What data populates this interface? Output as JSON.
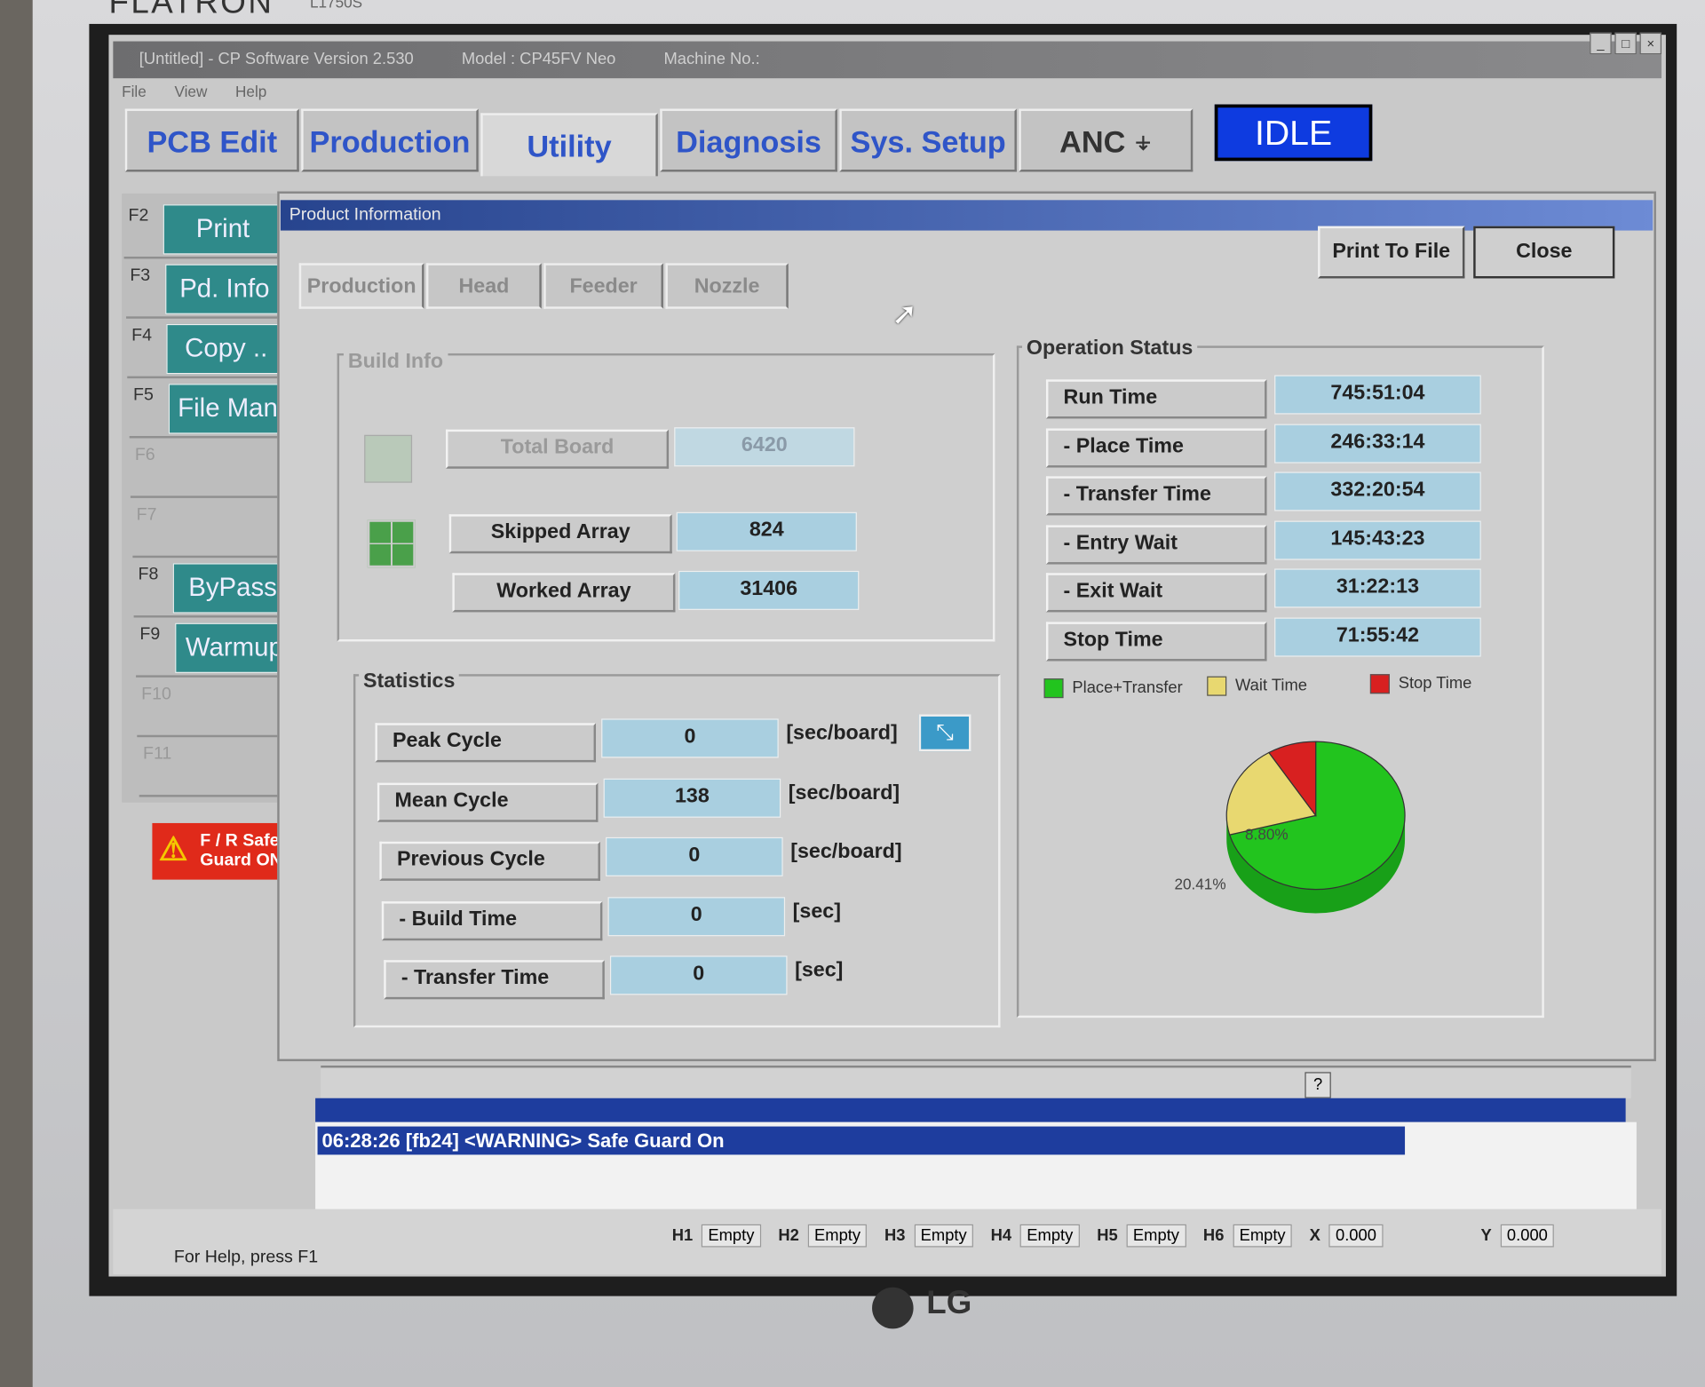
{
  "monitor": {
    "brand": "FLATRON",
    "model": "L1750S",
    "maker": "LG"
  },
  "window": {
    "title": "[Untitled] - CP Software Version 2.530",
    "model": "Model : CP45FV Neo",
    "machine": "Machine No.:"
  },
  "menu": [
    "File",
    "View",
    "Help"
  ],
  "main_tabs": [
    {
      "label": "PCB Edit"
    },
    {
      "label": "Production"
    },
    {
      "label": "Utility"
    },
    {
      "label": "Diagnosis"
    },
    {
      "label": "Sys. Setup"
    },
    {
      "label": "ANC"
    }
  ],
  "active_main_tab": "Utility",
  "state": {
    "label": "IDLE",
    "color": "#0e3be0"
  },
  "fkeys": [
    {
      "key": "F2",
      "label": "Print"
    },
    {
      "key": "F3",
      "label": "Pd. Info"
    },
    {
      "key": "F4",
      "label": "Copy .."
    },
    {
      "key": "F5",
      "label": "File Man"
    },
    {
      "key": "F6",
      "label": ""
    },
    {
      "key": "F7",
      "label": ""
    },
    {
      "key": "F8",
      "label": "ByPass"
    },
    {
      "key": "F9",
      "label": "Warmup"
    },
    {
      "key": "F10",
      "label": ""
    },
    {
      "key": "F11",
      "label": ""
    }
  ],
  "safeguard": {
    "line1": "F / R Safe",
    "line2": "Guard ON"
  },
  "dialog": {
    "title": "Product Information",
    "tabs": [
      "Production",
      "Head",
      "Feeder",
      "Nozzle"
    ],
    "print_to_file": "Print To File",
    "close": "Close",
    "build_info": {
      "title": "Build Info",
      "rows": [
        {
          "label": "Total Board",
          "value": "6420"
        },
        {
          "label": "Skipped Array",
          "value": "824"
        },
        {
          "label": "Worked Array",
          "value": "31406"
        }
      ]
    },
    "statistics": {
      "title": "Statistics",
      "rows": [
        {
          "label": "Peak Cycle",
          "value": "0",
          "unit": "[sec/board]"
        },
        {
          "label": "Mean Cycle",
          "value": "138",
          "unit": "[sec/board]"
        },
        {
          "label": "Previous Cycle",
          "value": "0",
          "unit": "[sec/board]"
        },
        {
          "label": "- Build Time",
          "value": "0",
          "unit": "[sec]"
        },
        {
          "label": "- Transfer Time",
          "value": "0",
          "unit": "[sec]"
        }
      ]
    },
    "operation_status": {
      "title": "Operation Status",
      "rows": [
        {
          "label": "Run Time",
          "value": "745:51:04"
        },
        {
          "label": "- Place Time",
          "value": "246:33:14"
        },
        {
          "label": "- Transfer Time",
          "value": "332:20:54"
        },
        {
          "label": "- Entry Wait",
          "value": "145:43:23"
        },
        {
          "label": "- Exit Wait",
          "value": "31:22:13"
        },
        {
          "label": "Stop Time",
          "value": "71:55:42"
        }
      ],
      "legend": [
        {
          "label": "Place+Transfer",
          "color": "#22c41e"
        },
        {
          "label": "Wait Time",
          "color": "#e8d870"
        },
        {
          "label": "Stop Time",
          "color": "#d82020"
        }
      ],
      "pie": [
        {
          "label": "70.79%",
          "value": 70.79,
          "color": "#22c41e"
        },
        {
          "label": "20.41%",
          "value": 20.41,
          "color": "#e8d870"
        },
        {
          "label": "8.80%",
          "value": 8.8,
          "color": "#d82020"
        }
      ]
    }
  },
  "help_button": "?",
  "log": {
    "message": "06:28:26 [fb24] <WARNING>  Safe Guard On"
  },
  "statusbar": {
    "help": "For Help, press F1",
    "heads": [
      {
        "h": "H1",
        "v": "Empty"
      },
      {
        "h": "H2",
        "v": "Empty"
      },
      {
        "h": "H3",
        "v": "Empty"
      },
      {
        "h": "H4",
        "v": "Empty"
      },
      {
        "h": "H5",
        "v": "Empty"
      },
      {
        "h": "H6",
        "v": "Empty"
      }
    ],
    "x_label": "X",
    "x": "0.000",
    "y_label": "Y",
    "y": "0.000"
  }
}
